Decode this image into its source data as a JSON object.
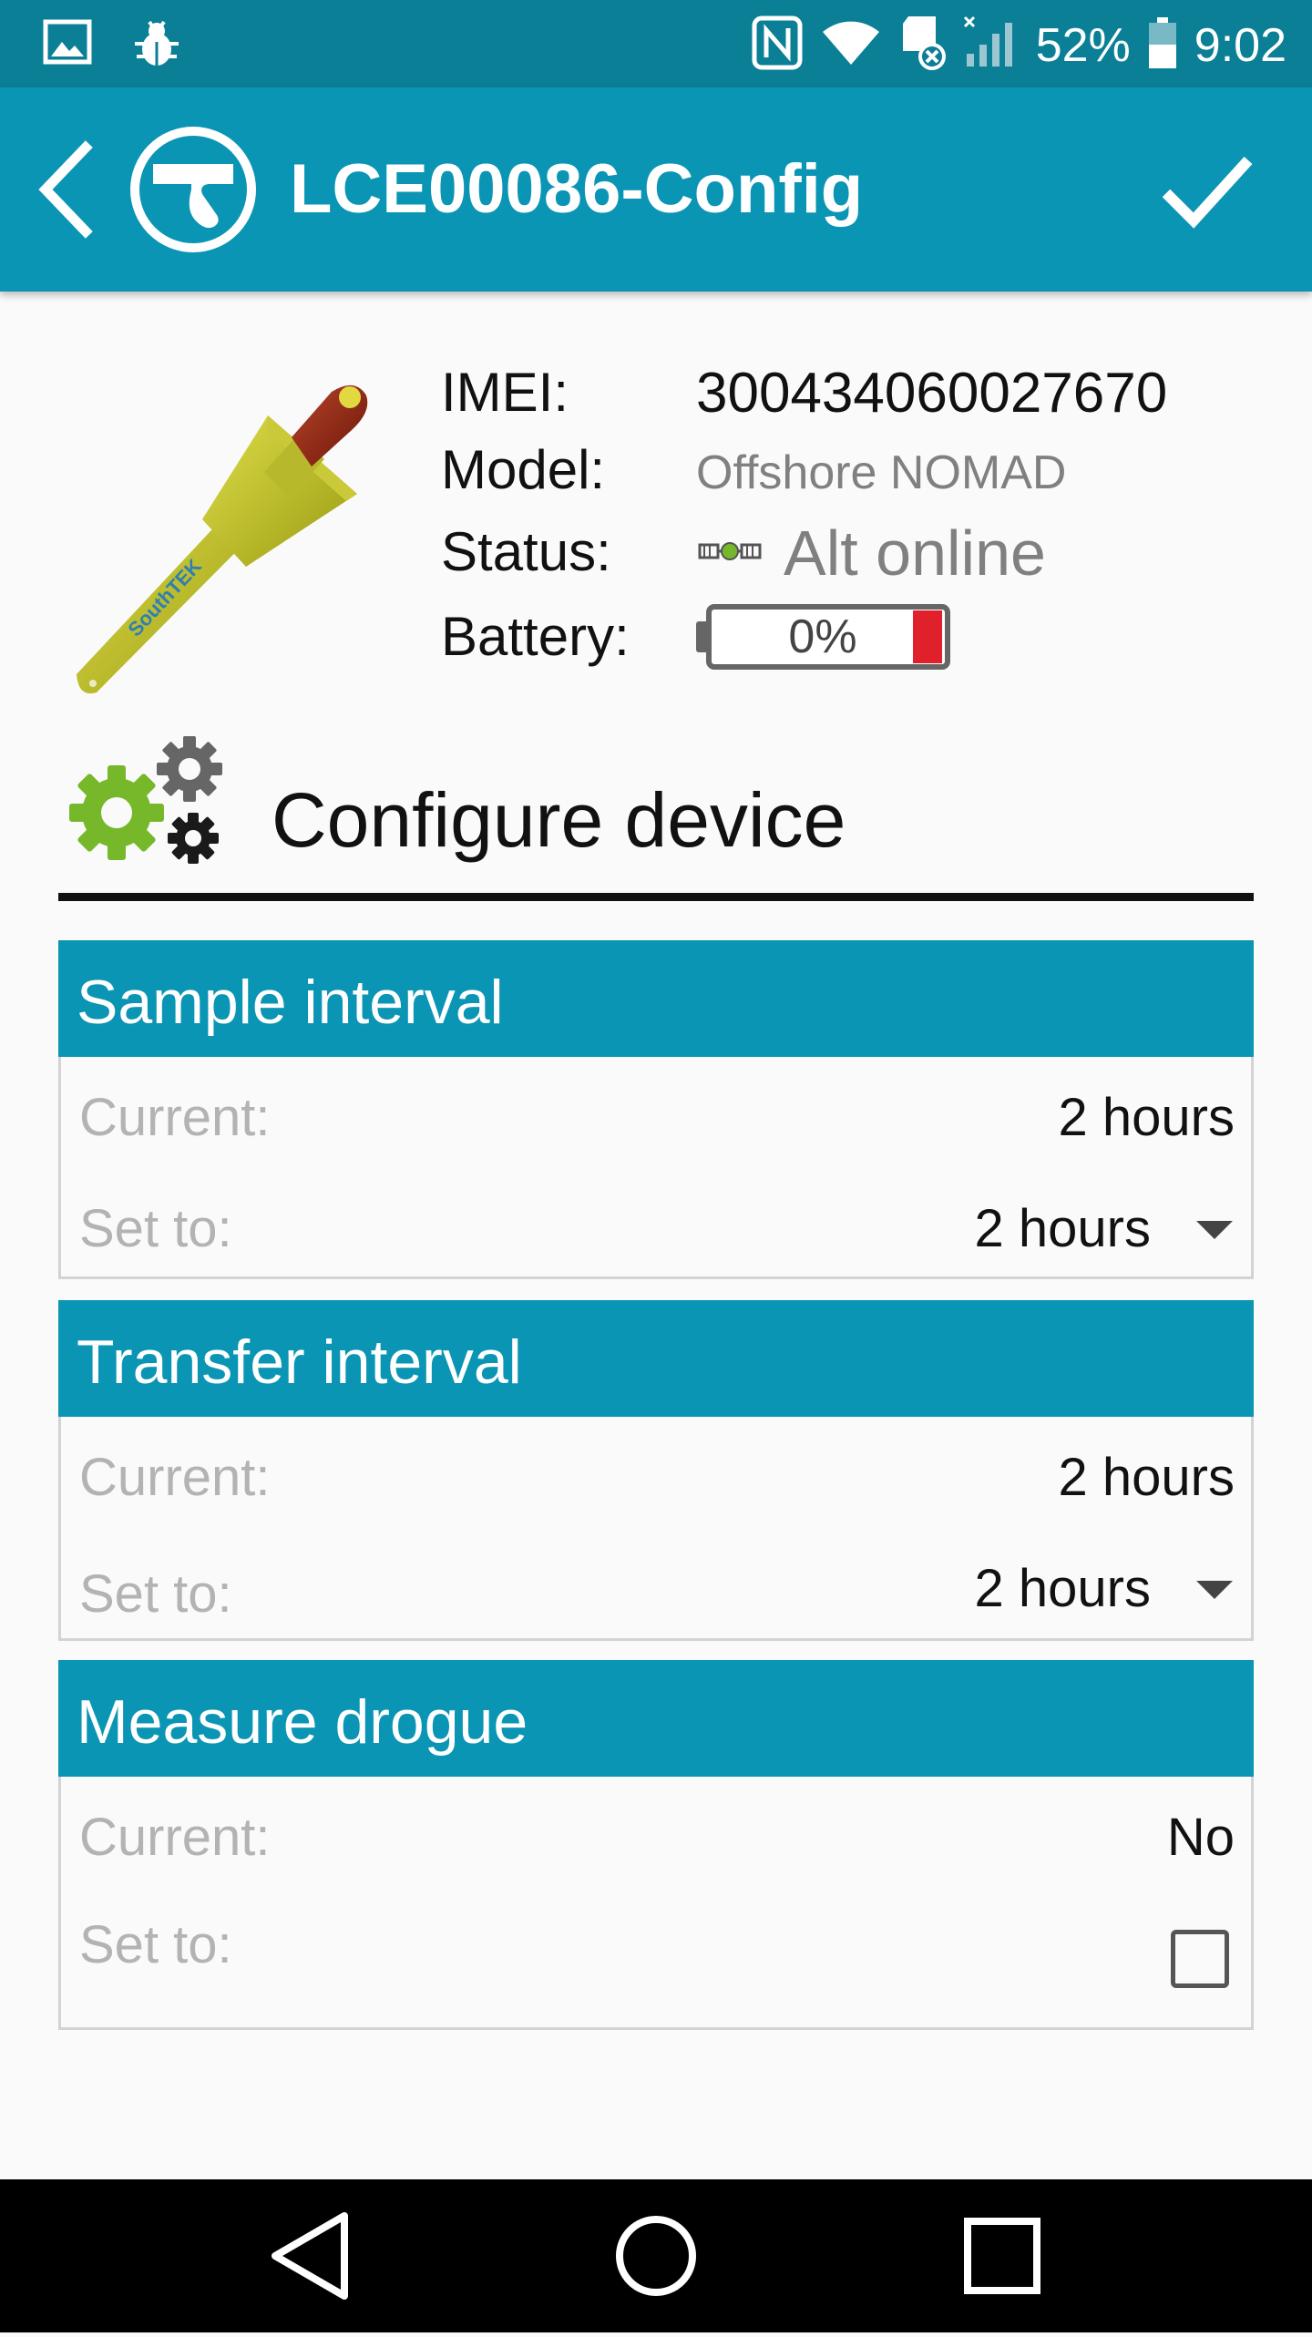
{
  "status_bar": {
    "battery_percent": "52%",
    "time": "9:02",
    "icons": [
      "gallery-icon",
      "bug-icon",
      "nfc-icon",
      "wifi-icon",
      "sd-card-icon",
      "signal-icon",
      "battery-icon"
    ]
  },
  "app_bar": {
    "title": "LCE00086-Config",
    "icons": [
      "back-arrow-icon",
      "app-logo-icon",
      "checkmark-icon"
    ]
  },
  "device": {
    "imei_label": "IMEI:",
    "imei": "300434060027670",
    "model_label": "Model:",
    "model": "Offshore NOMAD",
    "status_label": "Status:",
    "status": "Alt online",
    "battery_label": "Battery:",
    "battery_value": "0%",
    "battery_level": 0
  },
  "configure": {
    "title": "Configure device"
  },
  "settings": [
    {
      "title": "Sample interval",
      "current_label": "Current:",
      "current_value": "2 hours",
      "set_label": "Set to:",
      "set_value": "2 hours"
    },
    {
      "title": "Transfer interval",
      "current_label": "Current:",
      "current_value": "2 hours",
      "set_label": "Set to:",
      "set_value": "2 hours"
    },
    {
      "title": "Measure drogue",
      "current_label": "Current:",
      "current_value": "No",
      "set_label": "Set to:",
      "set_checked": false
    }
  ],
  "colors": {
    "app_bar": "#0b95b4",
    "status_bar": "#0b7f96",
    "card_header": "#0b95b4",
    "gear_green": "#76b82a",
    "battery_low": "#e0202a"
  },
  "nav_bar": {
    "icons": [
      "back-triangle-icon",
      "home-circle-icon",
      "recents-square-icon"
    ]
  }
}
